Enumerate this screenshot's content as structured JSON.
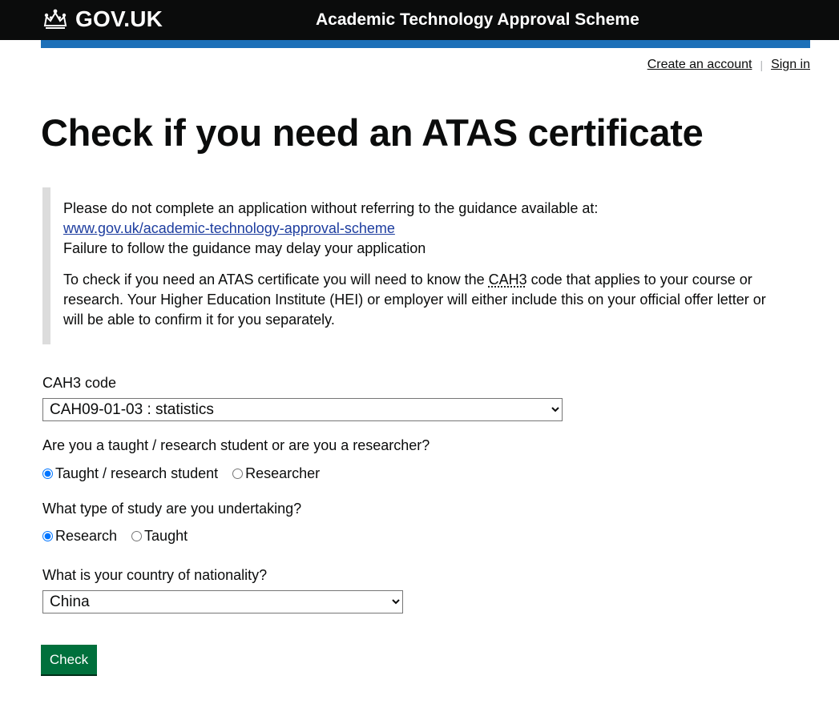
{
  "header": {
    "logo_text": "GOV.UK",
    "service_name": "Academic Technology Approval Scheme"
  },
  "account": {
    "create_account": "Create an account",
    "separator": "|",
    "sign_in": "Sign in"
  },
  "page": {
    "title": "Check if you need an ATAS certificate"
  },
  "inset": {
    "line1": "Please do not complete an application without referring to the guidance available at:",
    "link": "www.gov.uk/academic-technology-approval-scheme",
    "line2": "Failure to follow the guidance may delay your application",
    "para2_before": "To check if you need an ATAS certificate you will need to know the ",
    "para2_abbr": "CAH3",
    "para2_after": " code that applies to your course or research. Your Higher Education Institute (HEI) or employer will either include this on your official offer letter or will be able to confirm it for you separately."
  },
  "form": {
    "cah3": {
      "label": "CAH3 code",
      "selected": "CAH09-01-03 : statistics"
    },
    "student_type": {
      "question": "Are you a taught / research student or are you a researcher?",
      "options": [
        "Taught / research student",
        "Researcher"
      ],
      "selected": "Taught / research student"
    },
    "study_type": {
      "question": "What type of study are you undertaking?",
      "options": [
        "Research",
        "Taught"
      ],
      "selected": "Research"
    },
    "nationality": {
      "label": "What is your country of nationality?",
      "selected": "China"
    },
    "submit_label": "Check"
  },
  "colors": {
    "header_bg": "#0b0c0c",
    "accent_blue": "#1d70b8",
    "button_green": "#00703c",
    "link": "#1d3d9f",
    "inset_border": "#dcdcdc"
  }
}
